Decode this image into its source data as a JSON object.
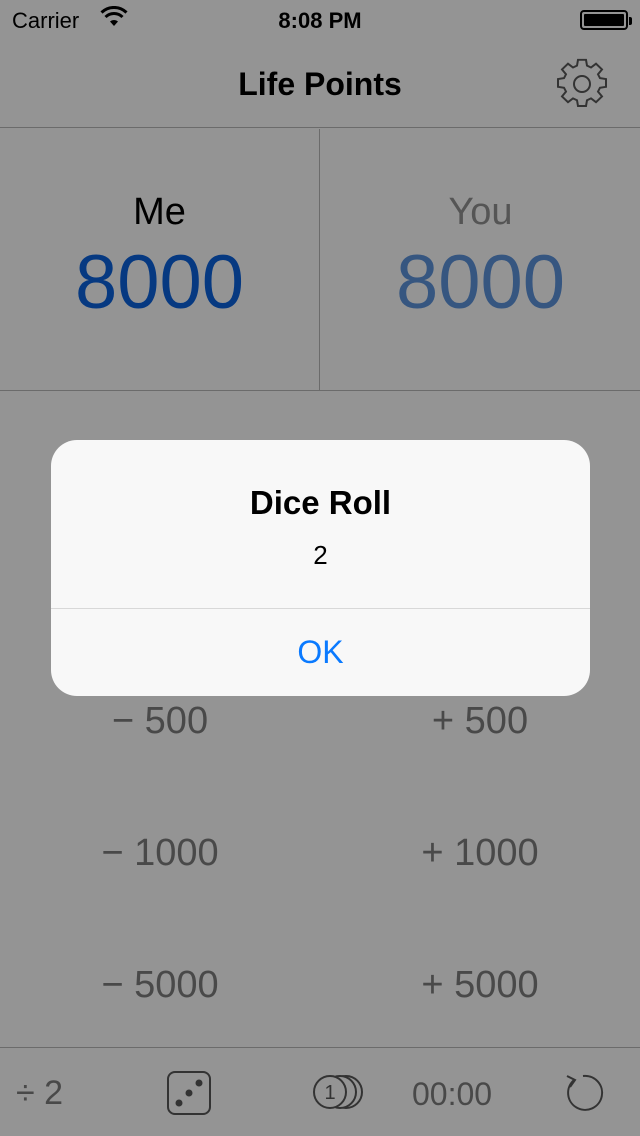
{
  "status_bar": {
    "carrier": "Carrier",
    "time": "8:08 PM",
    "wifi_icon": "wifi-icon",
    "battery_icon": "battery-icon"
  },
  "nav": {
    "title": "Life Points",
    "settings_icon": "gear-icon"
  },
  "players": {
    "me": {
      "name": "Me",
      "points": "8000"
    },
    "you": {
      "name": "You",
      "points": "8000"
    }
  },
  "adjust_buttons": {
    "minus_500": "− 500",
    "plus_500": "+ 500",
    "minus_1000": "− 1000",
    "plus_1000": "+ 1000",
    "minus_5000": "− 5000",
    "plus_5000": "+ 5000"
  },
  "toolbar": {
    "half_label": "÷ 2",
    "dice_icon": "dice-icon",
    "coin_icon": "coin-icon",
    "coin_face": "1",
    "timer": "00:00",
    "reset_icon": "reset-icon"
  },
  "alert": {
    "title": "Dice Roll",
    "message": "2",
    "ok_label": "OK"
  },
  "colors": {
    "accent": "#0a7aff",
    "me_points": "#0a5fd8",
    "you_points": "#5b8fd6",
    "muted_text": "#7b7b7b"
  }
}
